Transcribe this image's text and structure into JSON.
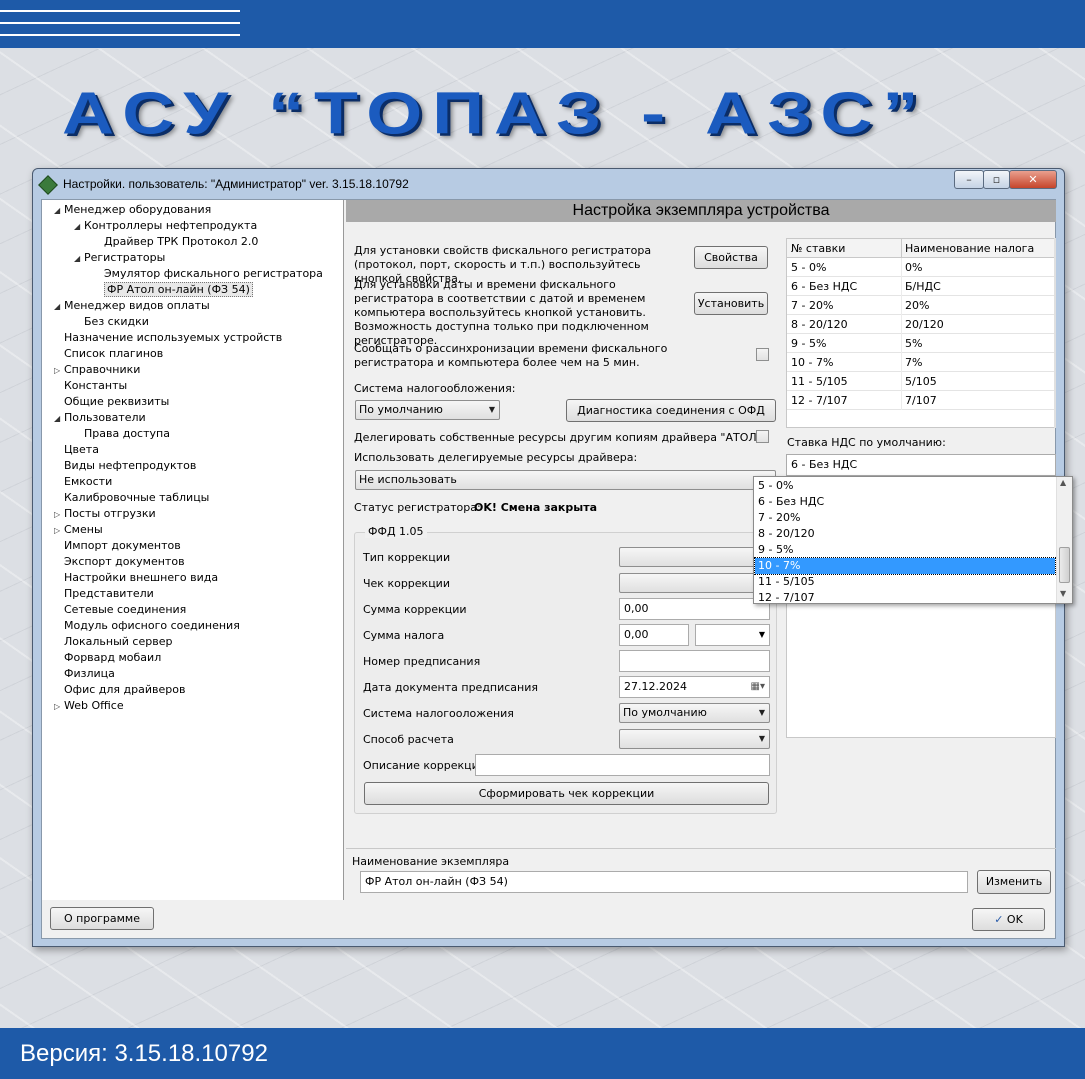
{
  "brand": {
    "title": "АСУ “ТОПАЗ - АЗС”"
  },
  "footer": {
    "version": "Версия: 3.15.18.10792"
  },
  "window": {
    "title": "Настройки. пользователь: \"Администратор\" ver. 3.15.18.10792",
    "buttons": {
      "minimize": "–",
      "maximize": "▫",
      "close": "✕"
    }
  },
  "tree": [
    {
      "label": "Менеджер оборудования",
      "toggle": "◢"
    },
    {
      "label": "Контроллеры нефтепродукта",
      "toggle": "◢"
    },
    {
      "label": "Драйвер ТРК Протокол 2.0",
      "toggle": ""
    },
    {
      "label": "Регистраторы",
      "toggle": "◢"
    },
    {
      "label": "Эмулятор фискального регистратора",
      "toggle": ""
    },
    {
      "label": "ФР Атол он-лайн (ФЗ 54)",
      "toggle": ""
    },
    {
      "label": "Менеджер видов оплаты",
      "toggle": "◢"
    },
    {
      "label": "Без скидки",
      "toggle": ""
    },
    {
      "label": "Назначение используемых устройств",
      "toggle": ""
    },
    {
      "label": "Список плагинов",
      "toggle": ""
    },
    {
      "label": "Справочники",
      "toggle": "▷"
    },
    {
      "label": "Константы",
      "toggle": ""
    },
    {
      "label": "Общие реквизиты",
      "toggle": ""
    },
    {
      "label": "Пользователи",
      "toggle": "◢"
    },
    {
      "label": "Права доступа",
      "toggle": ""
    },
    {
      "label": "Цвета",
      "toggle": ""
    },
    {
      "label": "Виды нефтепродуктов",
      "toggle": ""
    },
    {
      "label": "Емкости",
      "toggle": ""
    },
    {
      "label": "Калибровочные таблицы",
      "toggle": ""
    },
    {
      "label": "Посты отгрузки",
      "toggle": "▷"
    },
    {
      "label": "Смены",
      "toggle": "▷"
    },
    {
      "label": "Импорт документов",
      "toggle": ""
    },
    {
      "label": "Экспорт документов",
      "toggle": ""
    },
    {
      "label": "Настройки внешнего вида",
      "toggle": ""
    },
    {
      "label": "Представители",
      "toggle": ""
    },
    {
      "label": "Сетевые соединения",
      "toggle": ""
    },
    {
      "label": "Модуль офисного соединения",
      "toggle": ""
    },
    {
      "label": "Локальный сервер",
      "toggle": ""
    },
    {
      "label": "Форвард мобаил",
      "toggle": ""
    },
    {
      "label": "Физлица",
      "toggle": ""
    },
    {
      "label": "Офис для драйверов",
      "toggle": ""
    },
    {
      "label": "Web Office",
      "toggle": "▷"
    }
  ],
  "panel": {
    "header": "Настройка экземпляра устройства",
    "props_text": "Для установки свойств фискального регистратора (протокол, порт, скорость и т.п.) воспользуйтесь кнопкой свойства.",
    "props_button": "Свойства",
    "datetime_text": "Для установки даты и времени фискального регистратора в соответствии с датой и временем компьютера воспользуйтесь кнопкой установить. Возможность доступна только при подключенном регистраторе.",
    "set_button": "Установить",
    "desync_text": "Сообщать о рассинхронизации времени фискального регистратора и компьютера более чем на 5 мин.",
    "tax_label": "Система налогообложения:",
    "tax_value": "По умолчанию",
    "ofd_button": "Диагностика соединения с ОФД",
    "delegate_text": "Делегировать собственные ресурсы другим копиям драйвера \"АТОЛ\"",
    "use_delegated_label": "Использовать делегируемые ресурсы драйвера:",
    "use_delegated_value": "Не использовать",
    "status_label": "Статус регистратора:",
    "status_value": "OK! Смена закрыта"
  },
  "ffd": {
    "title": "ФФД 1.05",
    "correction_type_label": "Тип коррекции",
    "correction_check_label": "Чек коррекции",
    "correction_sum_label": "Сумма коррекции",
    "correction_sum_value": "0,00",
    "tax_sum_label": "Сумма налога",
    "tax_sum_value": "0,00",
    "prescription_num_label": "Номер предписания",
    "prescription_date_label": "Дата документа предписания",
    "prescription_date_value": "27.12.2024",
    "tax_system_label": "Система налогооложения",
    "tax_system_value": "По умолчанию",
    "calc_method_label": "Способ расчета",
    "correction_desc_label": "Описание коррекции",
    "make_check_button": "Сформировать чек коррекции"
  },
  "vat_grid": {
    "headers": [
      "№ ставки",
      "Наименование налога"
    ],
    "rows": [
      [
        "5 - 0%",
        "0%"
      ],
      [
        "6 - Без НДС",
        "Б/НДС"
      ],
      [
        "7 - 20%",
        "20%"
      ],
      [
        "8 - 20/120",
        "20/120"
      ],
      [
        "9 - 5%",
        "5%"
      ],
      [
        "10 - 7%",
        "7%"
      ],
      [
        "11 - 5/105",
        "5/105"
      ],
      [
        "12 - 7/107",
        "7/107"
      ]
    ]
  },
  "vat_default": {
    "label": "Ставка НДС по умолчанию:",
    "value": "6 - Без НДС",
    "options": [
      "5 - 0%",
      "6 - Без НДС",
      "7 - 20%",
      "8 - 20/120",
      "9 - 5%",
      "10 - 7%",
      "11 - 5/105",
      "12 - 7/107"
    ],
    "highlighted_index": 5
  },
  "instance": {
    "label": "Наименование экземпляра",
    "value": "ФР Атол он-лайн (ФЗ 54)",
    "change_button": "Изменить"
  },
  "bottom": {
    "about_button": "О программе",
    "ok_button": "OK"
  }
}
